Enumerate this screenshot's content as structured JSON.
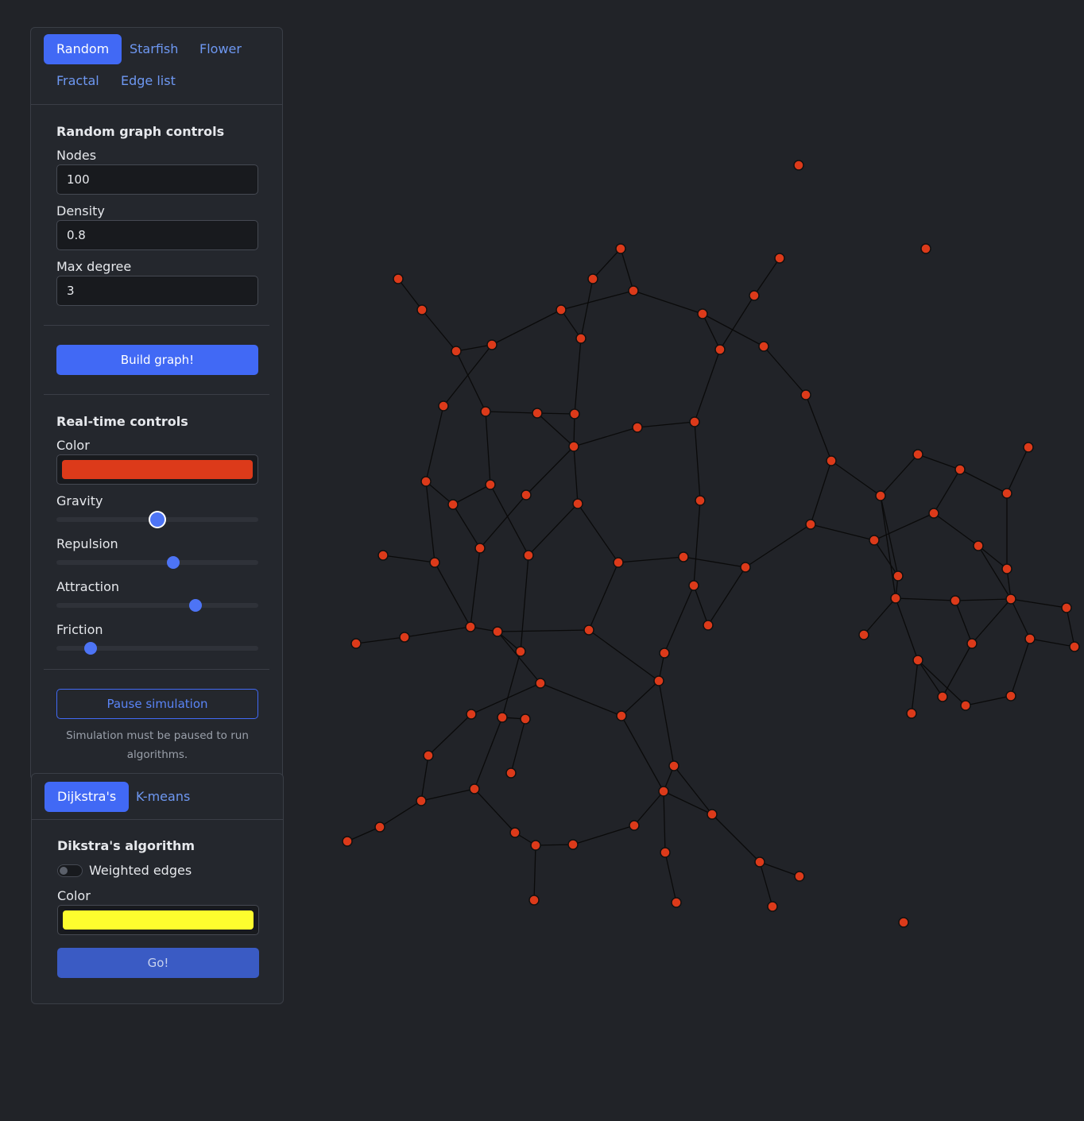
{
  "graph_tabs": [
    "Random",
    "Starfish",
    "Flower",
    "Fractal",
    "Edge list"
  ],
  "random_controls": {
    "title": "Random graph controls",
    "nodes_label": "Nodes",
    "nodes_value": "100",
    "density_label": "Density",
    "density_value": "0.8",
    "max_degree_label": "Max degree",
    "max_degree_value": "3",
    "build_button": "Build graph!"
  },
  "realtime_controls": {
    "title": "Real-time controls",
    "color_label": "Color",
    "color_value": "#dc3a1a",
    "gravity_label": "Gravity",
    "gravity_value": 0.5,
    "repulsion_label": "Repulsion",
    "repulsion_value": 0.58,
    "attraction_label": "Attraction",
    "attraction_value": 0.69,
    "friction_label": "Friction",
    "friction_value": 0.17,
    "pause_button": "Pause simulation",
    "hint": "Simulation must be paused to run algorithms."
  },
  "algorithm_tabs": [
    "Dijkstra's",
    "K-means"
  ],
  "dijkstra": {
    "title": "Dikstra's algorithm",
    "weighted_label": "Weighted edges",
    "weighted_on": false,
    "color_label": "Color",
    "color_value": "#fdfd2e",
    "go_button": "Go!"
  },
  "graph": {
    "node_color": "#dc3a1a",
    "node_outline": "#111111",
    "edge_color": "#0a0a0a"
  }
}
